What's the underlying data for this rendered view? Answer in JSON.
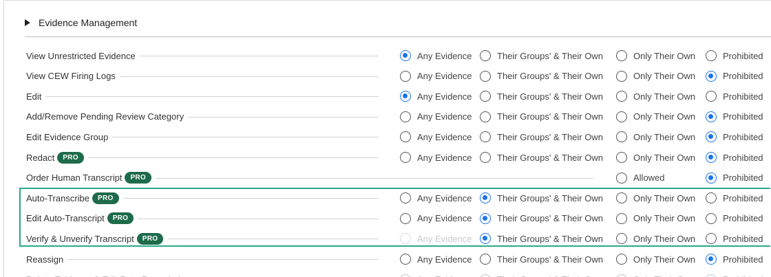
{
  "section": {
    "title": "Evidence Management"
  },
  "options": {
    "any": "Any Evidence",
    "groups": "Their Groups' & Their Own",
    "own": "Only Their Own",
    "prohibited": "Prohibited",
    "allowed": "Allowed"
  },
  "pro_label": "PRO",
  "rows": [
    {
      "label": "View Unrestricted Evidence",
      "selected": "any"
    },
    {
      "label": "View CEW Firing Logs",
      "selected": "prohibited"
    },
    {
      "label": "Edit",
      "selected": "any"
    },
    {
      "label": "Add/Remove Pending Review Category",
      "selected": "prohibited"
    },
    {
      "label": "Edit Evidence Group",
      "selected": "prohibited"
    },
    {
      "label": "Redact",
      "pro": true,
      "selected": "prohibited"
    },
    {
      "label": "Order Human Transcript",
      "pro": true,
      "selected": "prohibited",
      "binary": true
    },
    {
      "label": "Auto-Transcribe",
      "pro": true,
      "selected": "groups"
    },
    {
      "label": "Edit Auto-Transcript",
      "pro": true,
      "selected": "groups"
    },
    {
      "label": "Verify & Unverify Transcript",
      "pro": true,
      "selected": "groups",
      "disabled_any": true
    },
    {
      "label": "Reassign",
      "selected": "prohibited"
    },
    {
      "label": "Delete Evidence & Edit Date Recorded",
      "selected": "prohibited"
    }
  ],
  "colors": {
    "selected": "#1a73e8",
    "pro_badge": "#1d6b4a",
    "highlight": "#2aa889"
  }
}
